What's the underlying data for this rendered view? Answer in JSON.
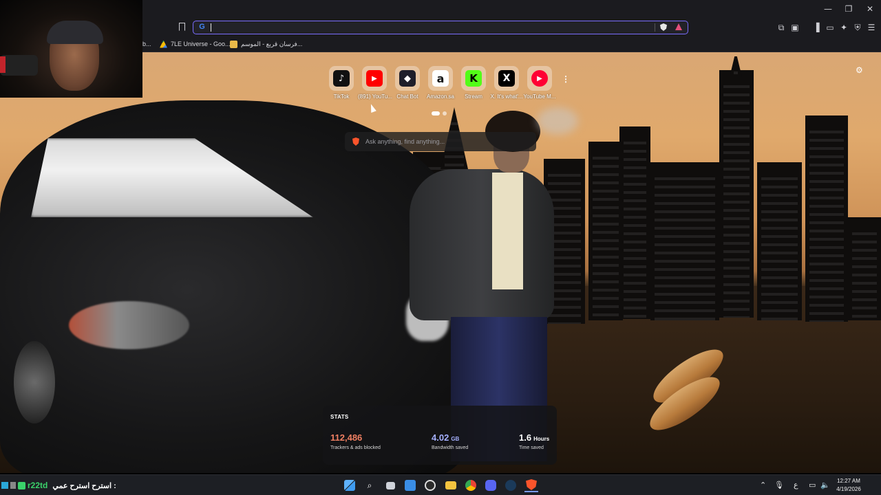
{
  "browser": {
    "url_value": "",
    "url_placeholder": "",
    "window_controls": {
      "minimize": "—",
      "restore": "❐",
      "close": "✕"
    },
    "bookmarks": [
      {
        "label": "b...",
        "color": "#888888"
      },
      {
        "label": "7LE Universe - Goo...",
        "color": "#fbbc04"
      },
      {
        "label": "فرسان قريع - الموسم...",
        "color": "#e9b949"
      }
    ]
  },
  "new_tab": {
    "top_sites": [
      {
        "label": "TikTok",
        "glyph": "♪",
        "bg": "#111111"
      },
      {
        "label": "(891) YouTu...",
        "glyph": "▶",
        "bg": "#ff0000"
      },
      {
        "label": "Chat Bot",
        "glyph": "◆",
        "bg": "#1e1e2a"
      },
      {
        "label": "Amazon.sa",
        "glyph": "a",
        "bg": "#ffffff"
      },
      {
        "label": "Stream",
        "glyph": "K",
        "bg": "#53fc18"
      },
      {
        "label": "X. It's what'...",
        "glyph": "X",
        "bg": "#000000"
      },
      {
        "label": "YouTube M...",
        "glyph": "▶",
        "bg": "#ff0033"
      }
    ],
    "more_glyph": "⋮",
    "settings_glyph": "⚙",
    "search_placeholder": "Ask anything, find anything...",
    "stats": {
      "title": "STATS",
      "trackers": {
        "value": "112,486",
        "unit": "",
        "label": "Trackers & ads blocked",
        "color": "#f07f62"
      },
      "bandwidth": {
        "value": "4.02",
        "unit": "GB",
        "label": "Bandwidth saved",
        "color": "#a5b0ff"
      },
      "time": {
        "value": "1.6",
        "unit": "Hours",
        "label": "Time saved",
        "color": "#ffffff"
      }
    }
  },
  "taskbar": {
    "ticker_symbol": "r22td",
    "ticker_message": "استرح استرح عمي :",
    "clock_time": "12:27 AM",
    "clock_date": "4/19/2026",
    "tray_lang": "ع"
  }
}
